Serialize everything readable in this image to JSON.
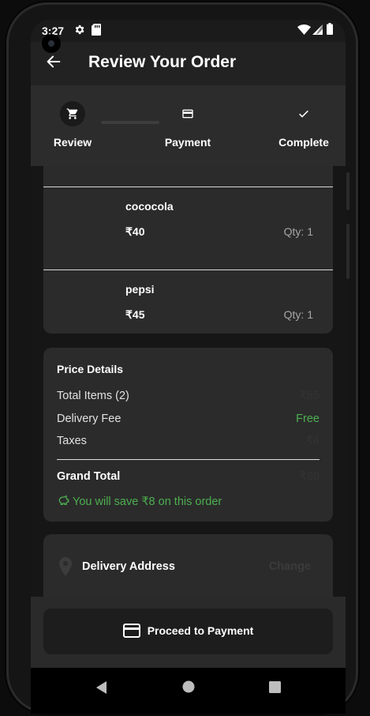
{
  "status_bar": {
    "time": "3:27",
    "icons": [
      "settings-icon",
      "sd-card-icon",
      "wifi-icon",
      "signal-icon",
      "battery-icon"
    ]
  },
  "app_bar": {
    "title": "Review Your Order",
    "back_icon": "arrow-left-icon"
  },
  "stepper": {
    "steps": [
      {
        "label": "Review",
        "icon": "cart-icon",
        "active": true
      },
      {
        "label": "Payment",
        "icon": "credit-card-icon",
        "active": false
      },
      {
        "label": "Complete",
        "icon": "check-icon",
        "active": false
      }
    ]
  },
  "order_items": [
    {
      "name": "cococola",
      "price": "₹40",
      "qty": "Qty: 1"
    },
    {
      "name": "pepsi",
      "price": "₹45",
      "qty": "Qty: 1"
    }
  ],
  "price_details": {
    "title": "Price Details",
    "rows": [
      {
        "label": "Total Items (2)",
        "value": "₹85"
      },
      {
        "label": "Delivery Fee",
        "value": "Free"
      },
      {
        "label": "Taxes",
        "value": "₹4"
      }
    ],
    "grand_total_label": "Grand Total",
    "grand_total_value": "₹89",
    "savings_text": "You will save ₹8 on this order"
  },
  "delivery_address": {
    "title": "Delivery Address",
    "change_label": "Change"
  },
  "proceed_button": {
    "label": "Proceed to Payment"
  },
  "colors": {
    "accent_green": "#4caf50",
    "screen_bg": "#161616",
    "card_bg": "#2b2b2b",
    "app_bar_bg": "#222222"
  }
}
